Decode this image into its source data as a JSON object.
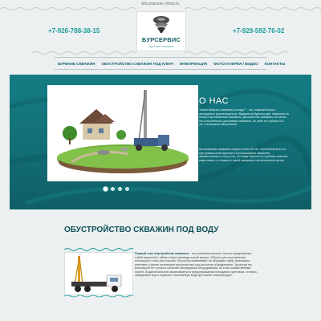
{
  "header": {
    "region": "Московская область",
    "logo_name": "БУРСЕРВИС",
    "logo_sub": "бурение скважин",
    "phone_left": "+7-926-788-38-15",
    "phone_right": "+7-929-592-76-02"
  },
  "nav": {
    "items": [
      {
        "label": "БУРЕНИЕ СКВАЖИН"
      },
      {
        "label": "ОБУСТРОЙСТВО СКВАЖИН ПОД КЛЮЧ"
      },
      {
        "label": "ИНФОРМАЦИЯ"
      },
      {
        "label": "ФОТОГАЛЕРЕЯ / ВИДЕО"
      },
      {
        "label": "КОНТАКТЫ"
      }
    ]
  },
  "hero": {
    "title": "О НАС",
    "p1": "\"Каких выбрать скважину на воду?\" - вот главный вопрос загородного домовладельца. Вариантов бурения две: скважина на песок и артезианская скважина. Достоинство скважины на песок - это относительно доложевая скважина, по цене ее глубина 5-8 лет и возможна засорением.",
    "p2": "Артезианская скважина служит около 50 лет, заполнением из-за при правильном бурении и использовании скважины заизвестковать в силу того, что вода берется из глубоких пластов известняка, и стоимость такой скважины соответственно выше.",
    "slides": 4,
    "active_slide": 1
  },
  "section": {
    "title": "ОБУСТРОЙСТВО СКВАЖИН ПОД ВОДУ",
    "lead": "Первый этап обустройства скважины",
    "text": " - это установка кессона. Кессон представляет собой закрытый с обеих сторон цилиндр полый внутри. Обычно для изготовления используют сталь или пластик. Кессон устанавливают на обсадную трубу, фиксируют, утепляют и далее используют пространство под кессоном оборудование. Зачастую его используют не только в качестве изолируемых оборудования, но и как хозяйственный погреб. Водяной кессона заканчивается в предотвращении попадания грунтовых, сточных, паводковых вод и поражает нежелаемую воду при низких температурах."
  },
  "colors": {
    "accent": "#1a9c9c",
    "hero_bg": "#157d85",
    "nav_text": "#0f6070",
    "page_bg": "#ecf0f0"
  }
}
